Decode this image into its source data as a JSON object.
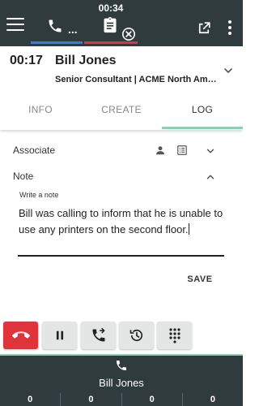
{
  "header": {
    "session_timer": "00:34",
    "call_tab_more": "...",
    "icons": [
      "menu-icon",
      "phone-icon",
      "clipboard-icon",
      "close-circle-icon",
      "popout-icon",
      "kebab-icon"
    ],
    "colors": {
      "bar": "#2f3b3d",
      "call_accent": "#2f7fe3",
      "task_accent": "#e0343c"
    }
  },
  "contact": {
    "time": "00:17",
    "name": "Bill Jones",
    "subtitle": "Senior Consultant | ACME North America"
  },
  "tabs": [
    {
      "label": "INFO",
      "active": false
    },
    {
      "label": "CREATE",
      "active": false
    },
    {
      "label": "LOG",
      "active": true
    }
  ],
  "log": {
    "associate_label": "Associate",
    "note_label": "Note",
    "note_field_label": "Write a note",
    "note_value": "Bill was calling to inform that he is unable to use any printers on the second floor.",
    "save_label": "SAVE"
  },
  "controls": [
    "hangup-icon",
    "pause-icon",
    "transfer-call-icon",
    "history-icon",
    "dialpad-icon"
  ],
  "footer": {
    "name": "Bill Jones",
    "counters": [
      "0",
      "0",
      "0",
      "0"
    ],
    "accent": "#8fcfb5"
  }
}
